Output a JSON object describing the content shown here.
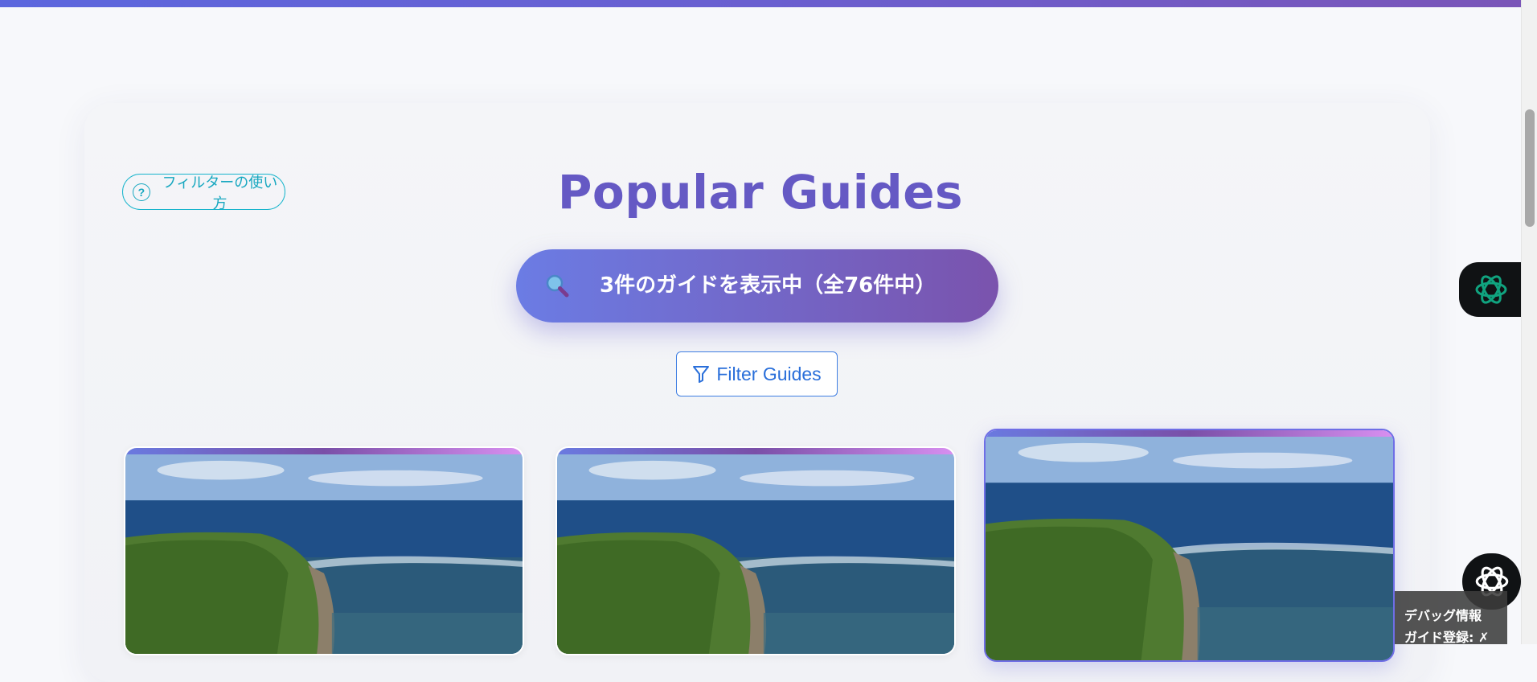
{
  "help": {
    "label": "フィルターの使い方",
    "icon": "question-circle-icon"
  },
  "header": {
    "title": "Popular Guides"
  },
  "results": {
    "summary": "3件のガイドを表示中（全76件中）",
    "icon": "search-icon"
  },
  "filter": {
    "label": "Filter Guides",
    "icon": "funnel-icon"
  },
  "cards": [
    {
      "image": "coastal-cliff-photo",
      "selected": false
    },
    {
      "image": "coastal-cliff-photo",
      "selected": false
    },
    {
      "image": "coastal-cliff-photo",
      "selected": true
    }
  ],
  "floating": {
    "chat_icon": "openai-logo-icon",
    "assistant_icon": "openai-logo-icon"
  },
  "debug": {
    "title": "デバッグ情報",
    "registered_label": "ガイド登録: ✗"
  },
  "colors": {
    "accent": "#6559c4",
    "pill_start": "#6b7ce4",
    "pill_end": "#7a53ad",
    "help": "#17b4cc",
    "filter": "#3f7ee2",
    "openai_green": "#10a37f"
  }
}
